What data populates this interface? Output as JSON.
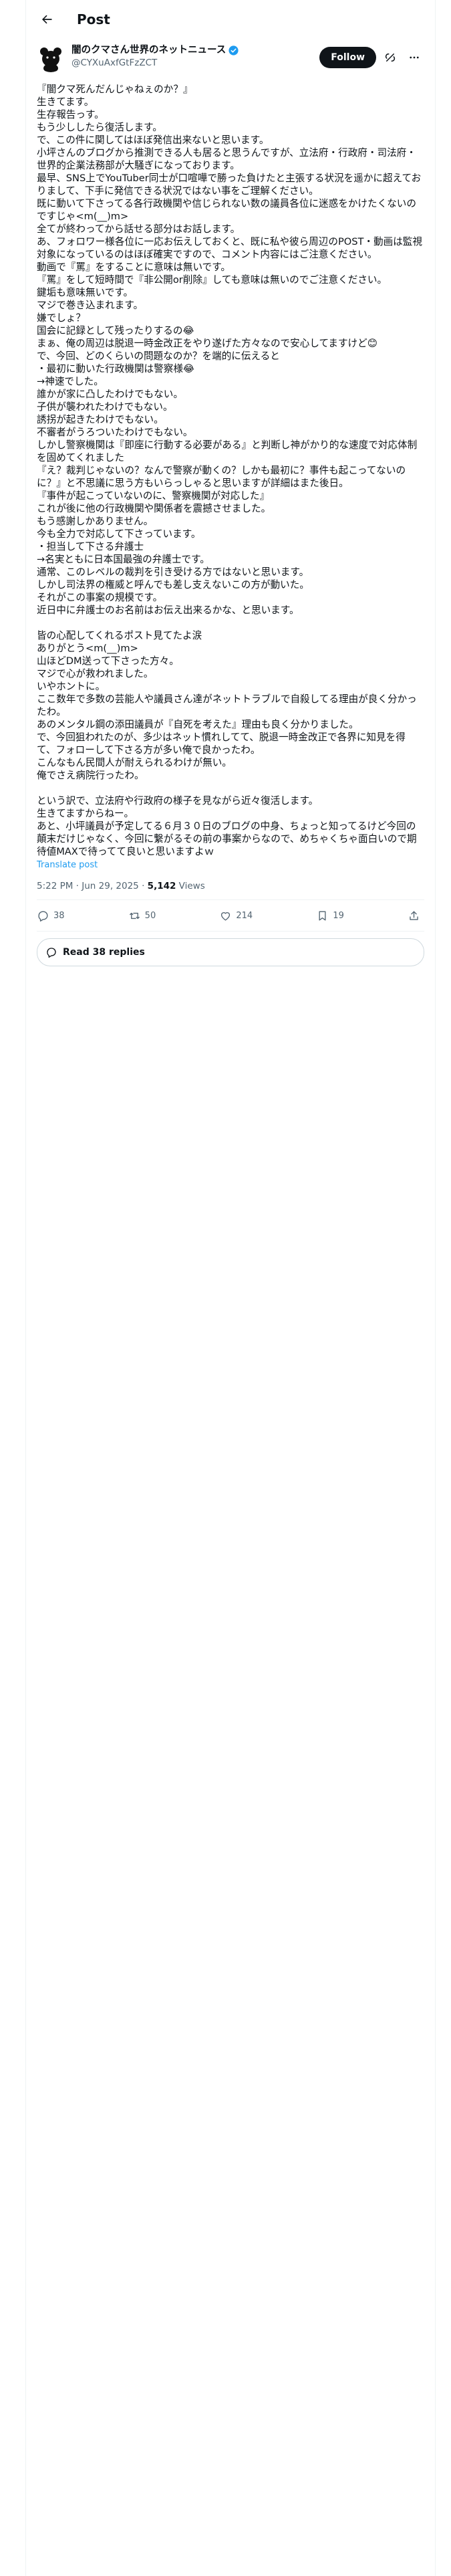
{
  "header": {
    "title": "Post"
  },
  "author": {
    "display_name": "闇のクマさん世界のネットニュース",
    "handle": "@CYXuAxfGtFzZCT",
    "follow_label": "Follow"
  },
  "post": {
    "lines": [
      "『闇クマ死んだんじゃねぇのか？』",
      "生きてます。",
      "生存報告っす。",
      "もう少ししたら復活します。",
      "で、この件に関してはほぼ発信出来ないと思います。",
      "小坪さんのブログから推測できる人も居ると思うんですが、立法府・行政府・司法府・世界的企業法務部が大騒ぎになっております。",
      "最早、SNS上でYouTuber同士が口喧嘩で勝った負けたと主張する状況を遥かに超えておりまして、下手に発信できる状況ではない事をご理解ください。",
      "既に動いて下さってる各行政機関や信じられない数の議員各位に迷惑をかけたくないのですじゃ<m(__)m>",
      "全てが終わってから話せる部分はお話します。",
      "あ、フォロワー様各位に一応お伝えしておくと、既に私や彼ら周辺のPOST・動画は監視対象になっているのはほぼ確実ですので、コメント内容にはご注意ください。",
      "動画で『罵』をすることに意味は無いです。",
      "『罵』をして短時間で『非公開or削除』しても意味は無いのでご注意ください。",
      "鍵垢も意味無いです。",
      "マジで巻き込まれます。",
      "嫌でしょ？",
      "国会に記録として残ったりするの😂",
      "まぁ、俺の周辺は脱退一時金改正をやり遂げた方々なので安心してますけど😊",
      "で、今回、どのくらいの問題なのか？を端的に伝えると",
      "・最初に動いた行政機関は警察様😂",
      "→神速でした。",
      "誰かが家に凸したわけでもない。",
      "子供が襲われたわけでもない。",
      "誘拐が起きたわけでもない。",
      "不審者がうろついたわけでもない。",
      "しかし警察機関は『即座に行動する必要がある』と判断し神がかり的な速度で対応体制を固めてくれました",
      "『え？裁判じゃないの？なんで警察が動くの？しかも最初に？事件も起こってないのに？』と不思議に思う方もいらっしゃると思いますが詳細はまた後日。",
      "『事件が起こっていないのに、警察機関が対応した』",
      "これが後に他の行政機関や関係者を震撼させました。",
      "もう感謝しかありません。",
      "今も全力で対応して下さっています。",
      "・担当して下さる弁護士",
      "→名実ともに日本国最強の弁護士です。",
      "通常、このレベルの裁判を引き受ける方ではないと思います。",
      "しかし司法界の権威と呼んでも差し支えないこの方が動いた。",
      "それがこの事案の規模です。",
      "近日中に弁護士のお名前はお伝え出来るかな、と思います。",
      "",
      "皆の心配してくれるポスト見てたよ涙",
      "ありがとう<m(__)m>",
      "山ほどDM送って下さった方々。",
      "マジで心が救われました。",
      "いやホントに。",
      "ここ数年で多数の芸能人や議員さん達がネットトラブルで自殺してる理由が良く分かったわ。",
      "あのメンタル鋼の添田議員が『自死を考えた』理由も良く分かりました。",
      "で、今回狙われたのが、多少はネット慣れしてて、脱退一時金改正で各界に知見を得て、フォローして下さる方が多い俺で良かったわ。",
      "こんなもん民間人が耐えられるわけが無い。",
      "俺でさえ病院行ったわ。",
      "",
      "という訳で、立法府や行政府の様子を見ながら近々復活します。",
      "生きてますからねー。",
      "あと、小坪議員が予定してる６月３０日のブログの中身、ちょっと知ってるけど今回の顛末だけじゃなく、今回に繋がるその前の事案からなので、めちゃくちゃ面白いので期待値MAXで待ってて良いと思いますよｗ"
    ],
    "translate_label": "Translate post",
    "timestamp": "5:22 PM · Jun 29, 2025",
    "views_count": "5,142",
    "views_label": "Views"
  },
  "actions": {
    "replies": "38",
    "reposts": "50",
    "likes": "214",
    "bookmarks": "19"
  },
  "read_replies_label": "Read 38 replies"
}
